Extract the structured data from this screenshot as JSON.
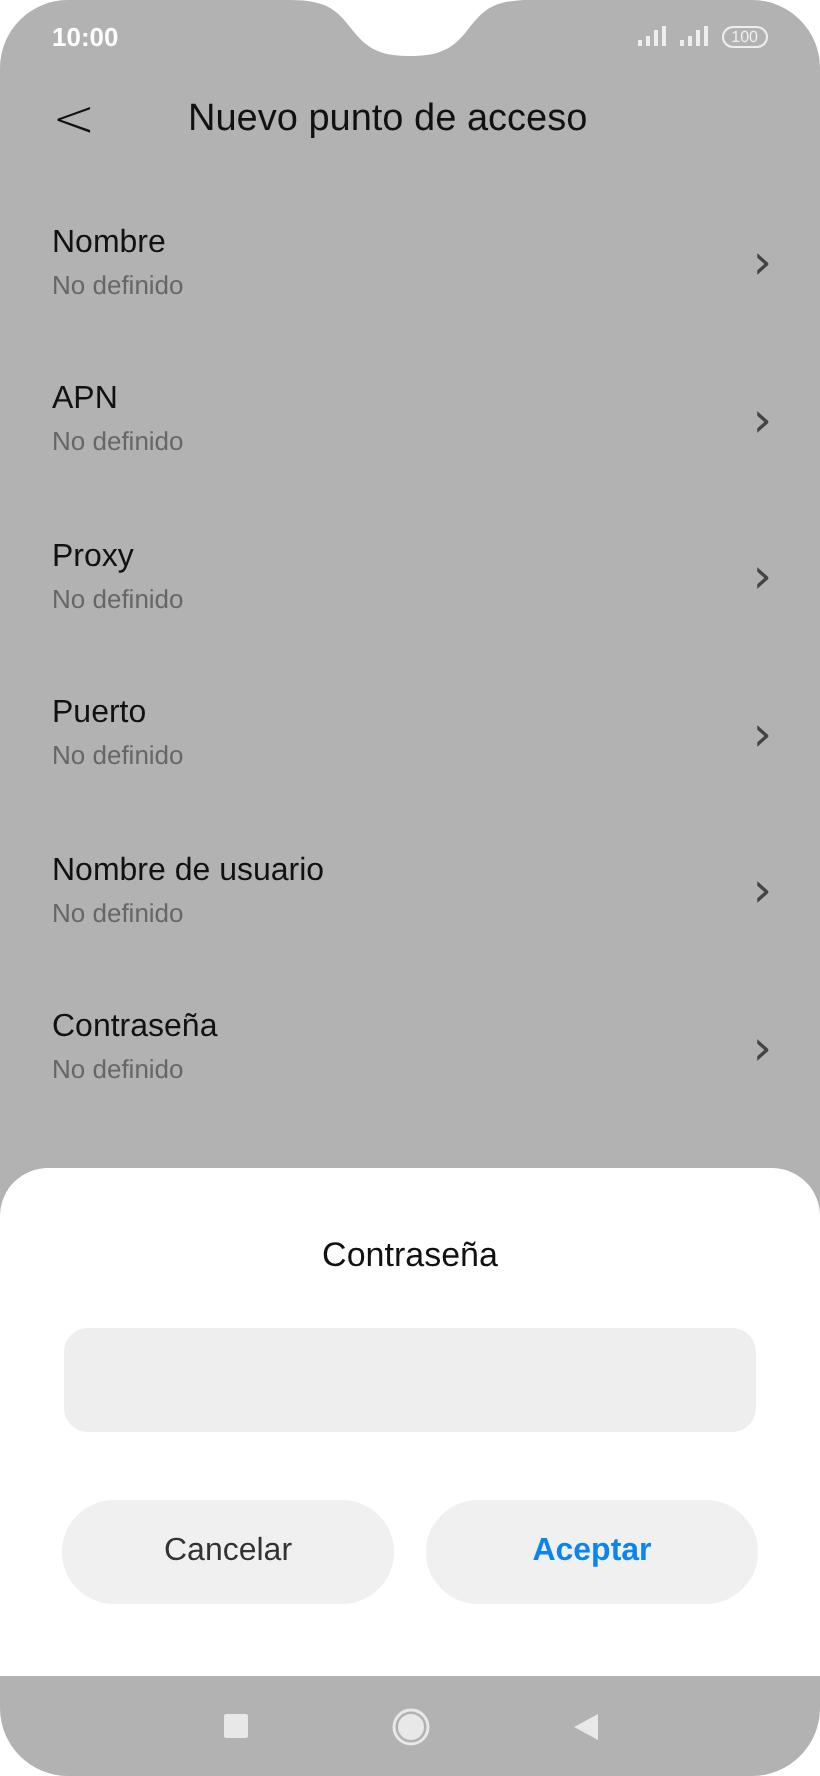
{
  "status_bar": {
    "time": "10:00",
    "battery": "100"
  },
  "header": {
    "back": "<",
    "title": "Nuevo punto de acceso"
  },
  "items": [
    {
      "title": "Nombre",
      "value": "No definido",
      "chevron": "›"
    },
    {
      "title": "APN",
      "value": "No definido",
      "chevron": "›"
    },
    {
      "title": "Proxy",
      "value": "No definido",
      "chevron": "›"
    },
    {
      "title": "Puerto",
      "value": "No definido",
      "chevron": "›"
    },
    {
      "title": "Nombre de usuario",
      "value": "No definido",
      "chevron": "›"
    },
    {
      "title": "Contraseña",
      "value": "No definido",
      "chevron": "›"
    }
  ],
  "dialog": {
    "title": "Contraseña",
    "buttons": [
      {
        "label": "Cancelar",
        "kind": "secondary"
      },
      {
        "label": "Aceptar",
        "kind": "primary"
      }
    ]
  }
}
